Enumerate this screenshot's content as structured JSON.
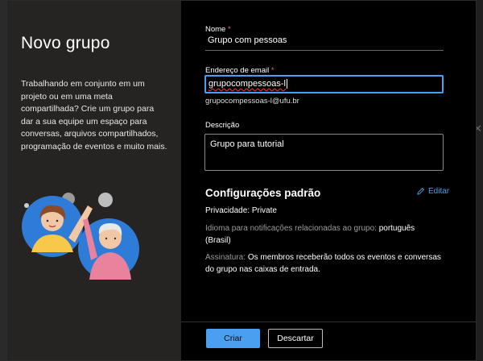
{
  "dialog": {
    "title": "Novo grupo",
    "description": "Trabalhando em conjunto em um projeto ou em uma meta compartilhada? Crie um grupo para dar a sua equipe um espaço para conversas, arquivos compartilhados, programação de eventos e muito mais."
  },
  "form": {
    "name_label": "Nome",
    "required_mark": "*",
    "name_value": "Grupo com pessoas",
    "email_label": "Endereço de email",
    "email_value": "grupocompessoas-l",
    "email_hint": "grupocompessoas-l@ufu.br",
    "description_label": "Descrição",
    "description_value": "Grupo para tutorial"
  },
  "settings": {
    "title": "Configurações padrão",
    "edit_label": "Editar",
    "privacy_label": "Privacidade:",
    "privacy_value": "Private",
    "language_label": "Idioma para notificações relacionadas ao grupo:",
    "language_value": "português",
    "language_region": "(Brasil)",
    "subscription_label": "Assinatura:",
    "subscription_value": "Os membros receberão todos os eventos e conversas do grupo nas caixas de entrada."
  },
  "footer": {
    "create_label": "Criar",
    "discard_label": "Descartar"
  },
  "colors": {
    "accent": "#4aa0f0",
    "left_panel": "#252423",
    "dialog_bg": "#000000"
  }
}
